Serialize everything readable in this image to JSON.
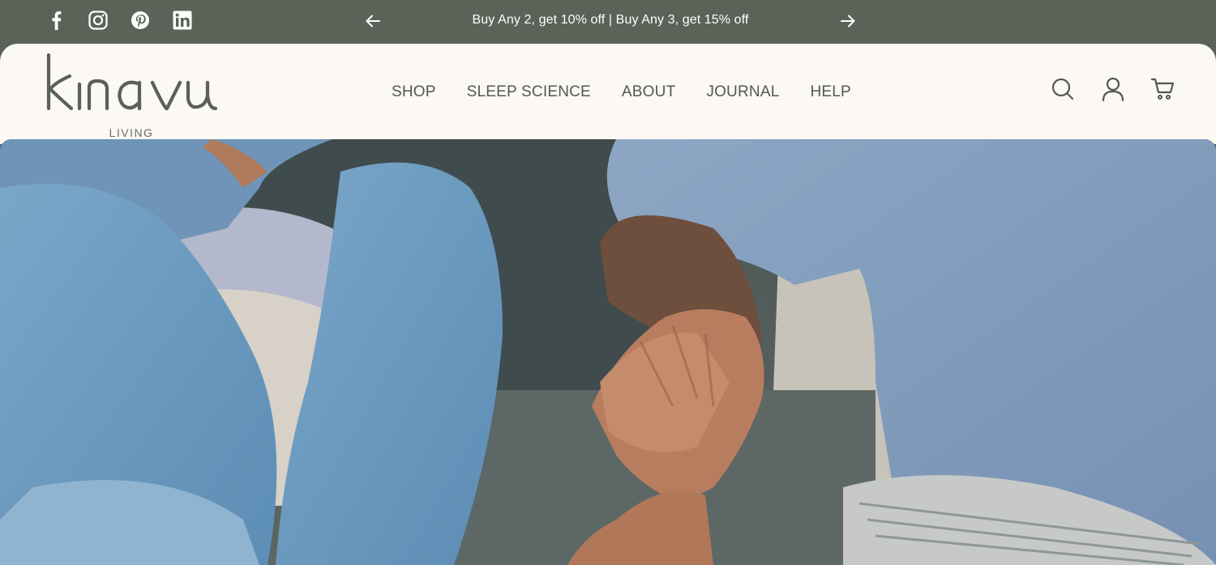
{
  "announcement": {
    "text": "Buy Any 2, get 10% off | Buy Any 3, get 15% off",
    "prev_icon": "arrow-left-icon",
    "next_icon": "arrow-right-icon"
  },
  "social": [
    {
      "name": "facebook",
      "icon": "facebook-icon"
    },
    {
      "name": "instagram",
      "icon": "instagram-icon"
    },
    {
      "name": "pinterest",
      "icon": "pinterest-icon"
    },
    {
      "name": "linkedin",
      "icon": "linkedin-icon"
    }
  ],
  "logo": {
    "wordmark": "kinavu",
    "subtitle": "LIVING"
  },
  "nav": {
    "items": [
      {
        "label": "SHOP"
      },
      {
        "label": "SLEEP SCIENCE"
      },
      {
        "label": "ABOUT"
      },
      {
        "label": "JOURNAL"
      },
      {
        "label": "HELP"
      }
    ]
  },
  "tools": {
    "search_icon": "search-icon",
    "account_icon": "user-icon",
    "cart_icon": "cart-icon"
  },
  "colors": {
    "topbar": "#5b6358",
    "header_bg": "#fcf8f3",
    "nav_text": "#4f5a50",
    "logo": "#5a6157"
  }
}
